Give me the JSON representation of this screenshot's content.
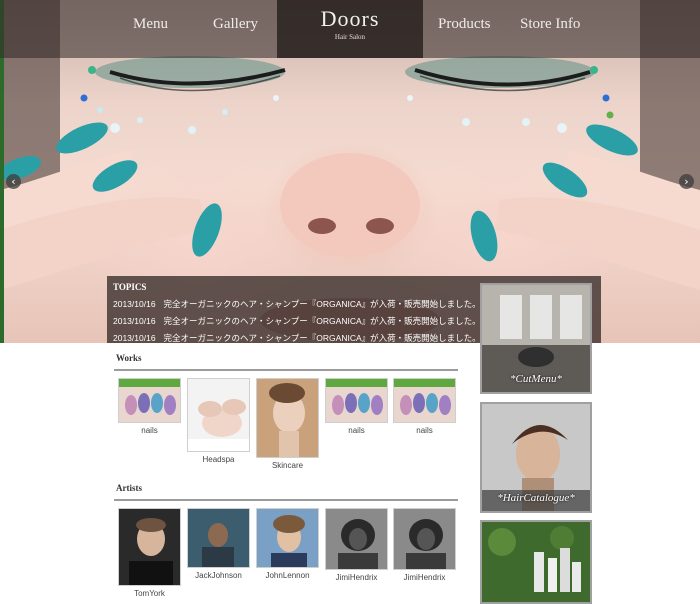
{
  "nav": {
    "items": [
      {
        "label": "Menu"
      },
      {
        "label": "Gallery"
      },
      {
        "label": "Products"
      },
      {
        "label": "Store Info"
      }
    ],
    "brand": {
      "title": "Doors",
      "subtitle": "Hair Salon"
    }
  },
  "slider": {
    "prev_icon": "‹",
    "next_icon": "›"
  },
  "topics": {
    "title": "TOPICS",
    "items": [
      {
        "date": "2013/10/16",
        "text": "完全オーガニックのヘア・シャンプー『ORGANICA』が入荷・販売開始しました。"
      },
      {
        "date": "2013/10/16",
        "text": "完全オーガニックのヘア・シャンプー『ORGANICA』が入荷・販売開始しました。"
      },
      {
        "date": "2013/10/16",
        "text": "完全オーガニックのヘア・シャンプー『ORGANICA』が入荷・販売開始しました。"
      }
    ]
  },
  "works": {
    "title": "Works",
    "items": [
      {
        "label": "nails"
      },
      {
        "label": "Headspa"
      },
      {
        "label": "Skincare"
      },
      {
        "label": "nails"
      },
      {
        "label": "nails"
      }
    ]
  },
  "artists": {
    "title": "Artists",
    "items": [
      {
        "label": "TomYork"
      },
      {
        "label": "JackJohnson"
      },
      {
        "label": "JohnLennon"
      },
      {
        "label": "JimiHendrix"
      },
      {
        "label": "JimiHendrix"
      }
    ]
  },
  "sidebar": {
    "banners": [
      {
        "label": "*CutMenu*"
      },
      {
        "label": "*HairCatalogue*"
      },
      {
        "label": ""
      }
    ]
  },
  "colors": {
    "nav_bg": "#32282680",
    "brand_bg": "#231c1a",
    "nail_teal": "#2a9fa6",
    "rule": "#9c9c9c"
  }
}
